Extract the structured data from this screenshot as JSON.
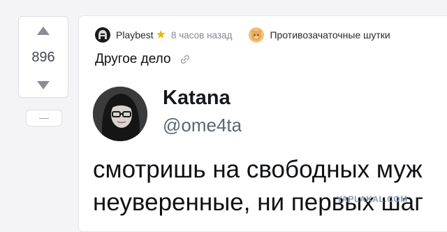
{
  "vote": {
    "count": "896",
    "collapse_label": "—"
  },
  "post": {
    "author": "Playbest",
    "time": "8 часов назад",
    "community": "Противозачаточные шутки",
    "title": "Другое дело"
  },
  "tweet": {
    "name": "Katana",
    "handle": "@ome4ta",
    "line1": "смотришь на свободных муж",
    "line2": "неуверенные, ни первых шаг"
  },
  "watermark": "YAPLAKAL.COM",
  "colors": {
    "star": "#f3b200",
    "vote_arrow": "#8a8d94"
  }
}
